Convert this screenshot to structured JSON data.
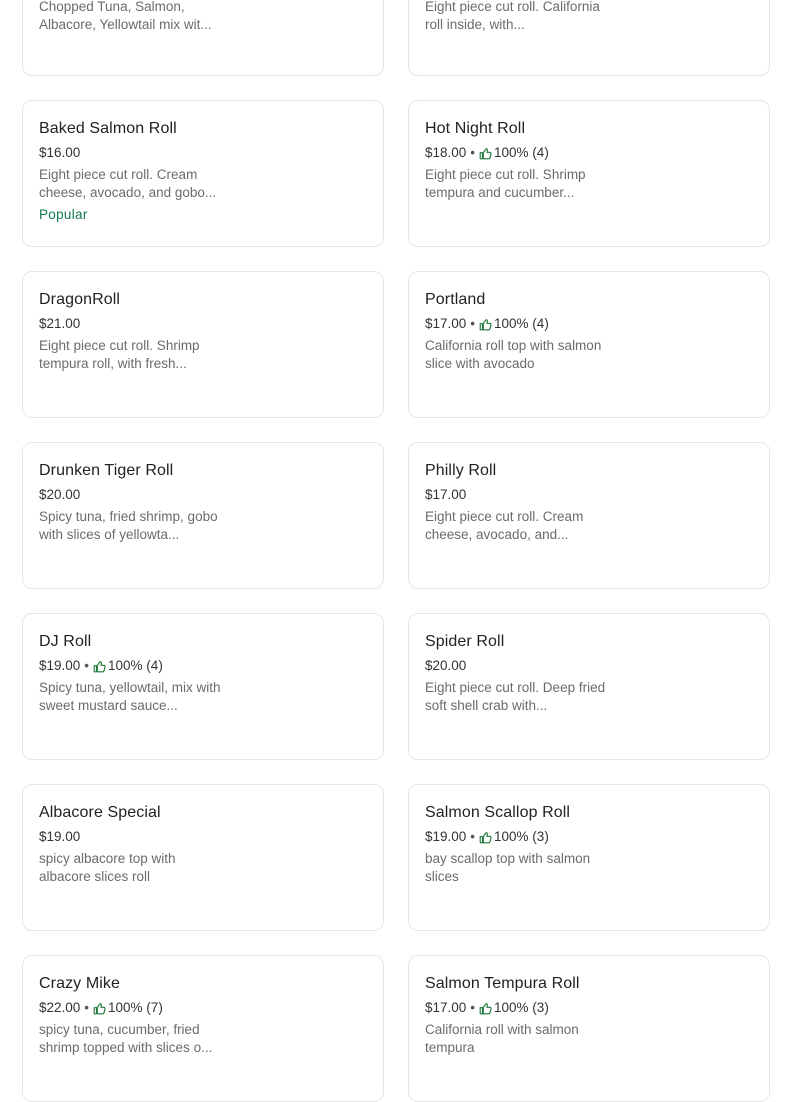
{
  "colors": {
    "accent_green": "#117a4b",
    "thumb_icon": "#1e7a3a",
    "border": "#e6e6e6"
  },
  "items": [
    {
      "name": "",
      "price": "",
      "rating": "",
      "desc": "Chopped Tuna, Salmon, Albacore, Yellowtail mix wit...",
      "badge": ""
    },
    {
      "name": "",
      "price": "",
      "rating": "",
      "desc": "Eight piece cut roll. California roll inside, with...",
      "badge": ""
    },
    {
      "name": "Baked Salmon Roll",
      "price": "$16.00",
      "rating": "",
      "desc": "Eight piece cut roll. Cream cheese, avocado, and gobo...",
      "badge": "Popular"
    },
    {
      "name": "Hot Night Roll",
      "price": "$18.00",
      "rating": "100% (4)",
      "desc": "Eight piece cut roll. Shrimp tempura and cucumber...",
      "badge": ""
    },
    {
      "name": "DragonRoll",
      "price": "$21.00",
      "rating": "",
      "desc": "Eight piece cut roll. Shrimp tempura roll, with fresh...",
      "badge": ""
    },
    {
      "name": "Portland",
      "price": "$17.00",
      "rating": "100% (4)",
      "desc": "California roll top with salmon slice with avocado",
      "badge": ""
    },
    {
      "name": "Drunken Tiger Roll",
      "price": "$20.00",
      "rating": "",
      "desc": "Spicy tuna, fried shrimp, gobo with slices of yellowta...",
      "badge": ""
    },
    {
      "name": "Philly Roll",
      "price": "$17.00",
      "rating": "",
      "desc": "Eight piece cut roll. Cream cheese, avocado, and...",
      "badge": ""
    },
    {
      "name": "DJ Roll",
      "price": "$19.00",
      "rating": "100% (4)",
      "desc": "Spicy tuna, yellowtail, mix with sweet mustard sauce...",
      "badge": ""
    },
    {
      "name": "Spider Roll",
      "price": "$20.00",
      "rating": "",
      "desc": "Eight piece cut roll. Deep fried soft shell crab with...",
      "badge": ""
    },
    {
      "name": "Albacore Special",
      "price": "$19.00",
      "rating": "",
      "desc": "spicy albacore top with albacore slices roll",
      "badge": ""
    },
    {
      "name": "Salmon Scallop Roll",
      "price": "$19.00",
      "rating": "100% (3)",
      "desc": "bay scallop top with salmon slices",
      "badge": ""
    },
    {
      "name": "Crazy Mike",
      "price": "$22.00",
      "rating": "100% (7)",
      "desc": "spicy tuna, cucumber, fried shrimp topped with slices o...",
      "badge": ""
    },
    {
      "name": "Salmon Tempura Roll",
      "price": "$17.00",
      "rating": "100% (3)",
      "desc": "California roll with salmon tempura",
      "badge": ""
    }
  ]
}
